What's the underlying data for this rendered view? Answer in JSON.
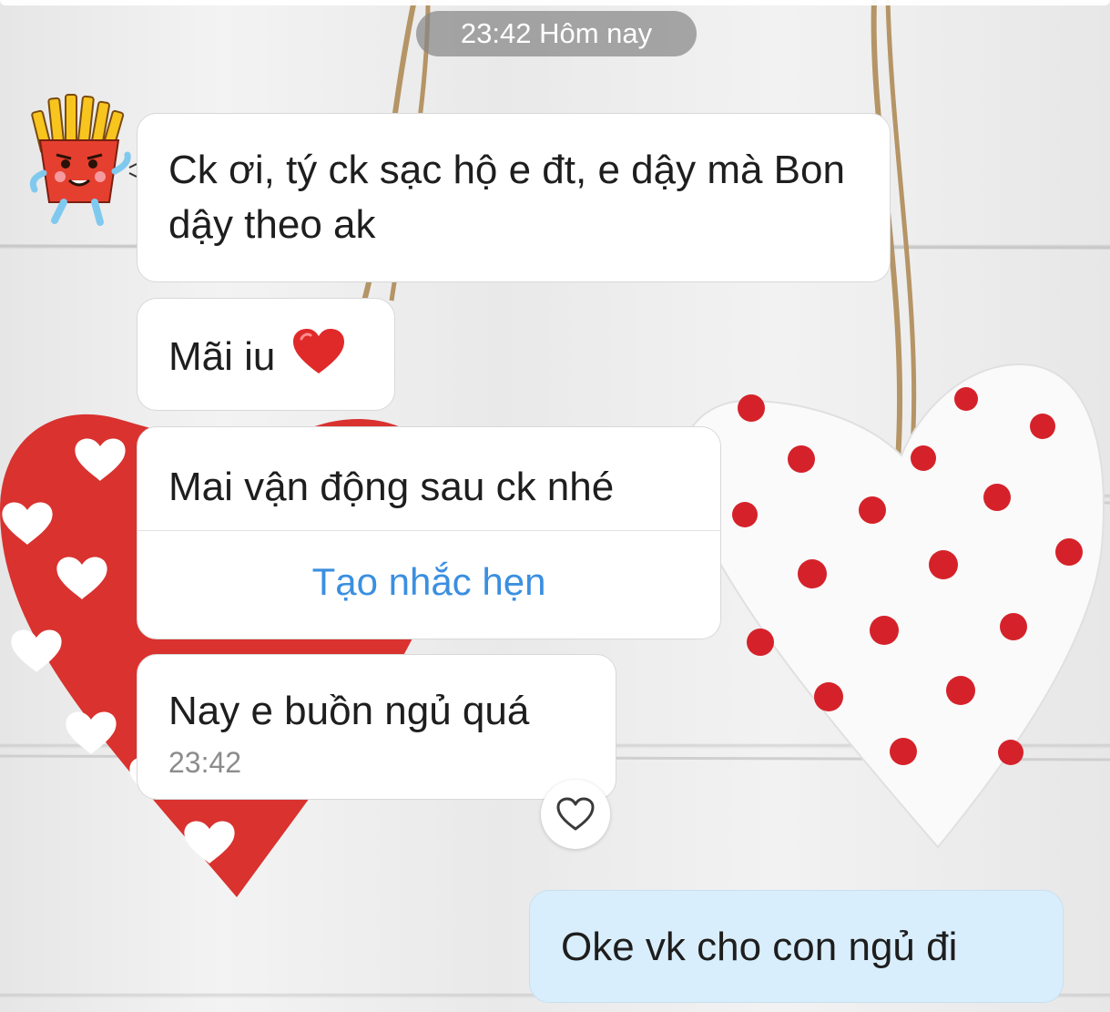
{
  "chat": {
    "date_label": "23:42 Hôm nay",
    "messages": [
      {
        "sender": "other",
        "text": "Ck ơi, tý ck sạc hộ e đt, e dậy mà Bon dậy theo ak"
      },
      {
        "sender": "other",
        "text": "Mãi iu",
        "emoji": "red-heart"
      },
      {
        "sender": "other",
        "text": "Mai vận động sau ck nhé",
        "action_label": "Tạo nhắc hẹn"
      },
      {
        "sender": "other",
        "text": "Nay e buồn ngủ quá",
        "time": "23:42"
      },
      {
        "sender": "me",
        "text": "Oke vk cho con ngủ đi"
      }
    ]
  },
  "icons": {
    "avatar": "french-fries-sticker-avatar",
    "react": "heart-outline-icon",
    "emoji": "red-heart-emoji"
  },
  "colors": {
    "incoming_bubble": "#ffffff",
    "outgoing_bubble": "#d9eefc",
    "link": "#3b8fe0",
    "timestamp": "#8c8c8c",
    "date_pill": "#878787"
  }
}
